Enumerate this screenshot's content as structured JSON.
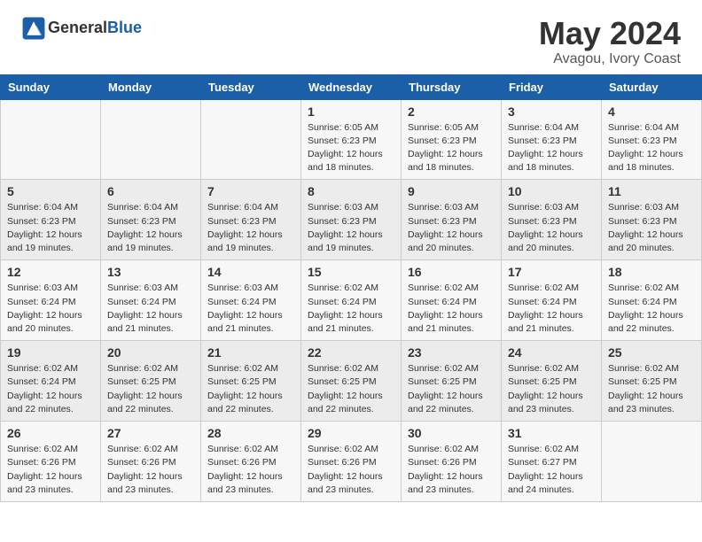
{
  "header": {
    "logo_line1": "General",
    "logo_line2": "Blue",
    "month": "May 2024",
    "location": "Avagou, Ivory Coast"
  },
  "weekdays": [
    "Sunday",
    "Monday",
    "Tuesday",
    "Wednesday",
    "Thursday",
    "Friday",
    "Saturday"
  ],
  "weeks": [
    [
      {
        "day": "",
        "info": ""
      },
      {
        "day": "",
        "info": ""
      },
      {
        "day": "",
        "info": ""
      },
      {
        "day": "1",
        "info": "Sunrise: 6:05 AM\nSunset: 6:23 PM\nDaylight: 12 hours\nand 18 minutes."
      },
      {
        "day": "2",
        "info": "Sunrise: 6:05 AM\nSunset: 6:23 PM\nDaylight: 12 hours\nand 18 minutes."
      },
      {
        "day": "3",
        "info": "Sunrise: 6:04 AM\nSunset: 6:23 PM\nDaylight: 12 hours\nand 18 minutes."
      },
      {
        "day": "4",
        "info": "Sunrise: 6:04 AM\nSunset: 6:23 PM\nDaylight: 12 hours\nand 18 minutes."
      }
    ],
    [
      {
        "day": "5",
        "info": "Sunrise: 6:04 AM\nSunset: 6:23 PM\nDaylight: 12 hours\nand 19 minutes."
      },
      {
        "day": "6",
        "info": "Sunrise: 6:04 AM\nSunset: 6:23 PM\nDaylight: 12 hours\nand 19 minutes."
      },
      {
        "day": "7",
        "info": "Sunrise: 6:04 AM\nSunset: 6:23 PM\nDaylight: 12 hours\nand 19 minutes."
      },
      {
        "day": "8",
        "info": "Sunrise: 6:03 AM\nSunset: 6:23 PM\nDaylight: 12 hours\nand 19 minutes."
      },
      {
        "day": "9",
        "info": "Sunrise: 6:03 AM\nSunset: 6:23 PM\nDaylight: 12 hours\nand 20 minutes."
      },
      {
        "day": "10",
        "info": "Sunrise: 6:03 AM\nSunset: 6:23 PM\nDaylight: 12 hours\nand 20 minutes."
      },
      {
        "day": "11",
        "info": "Sunrise: 6:03 AM\nSunset: 6:23 PM\nDaylight: 12 hours\nand 20 minutes."
      }
    ],
    [
      {
        "day": "12",
        "info": "Sunrise: 6:03 AM\nSunset: 6:24 PM\nDaylight: 12 hours\nand 20 minutes."
      },
      {
        "day": "13",
        "info": "Sunrise: 6:03 AM\nSunset: 6:24 PM\nDaylight: 12 hours\nand 21 minutes."
      },
      {
        "day": "14",
        "info": "Sunrise: 6:03 AM\nSunset: 6:24 PM\nDaylight: 12 hours\nand 21 minutes."
      },
      {
        "day": "15",
        "info": "Sunrise: 6:02 AM\nSunset: 6:24 PM\nDaylight: 12 hours\nand 21 minutes."
      },
      {
        "day": "16",
        "info": "Sunrise: 6:02 AM\nSunset: 6:24 PM\nDaylight: 12 hours\nand 21 minutes."
      },
      {
        "day": "17",
        "info": "Sunrise: 6:02 AM\nSunset: 6:24 PM\nDaylight: 12 hours\nand 21 minutes."
      },
      {
        "day": "18",
        "info": "Sunrise: 6:02 AM\nSunset: 6:24 PM\nDaylight: 12 hours\nand 22 minutes."
      }
    ],
    [
      {
        "day": "19",
        "info": "Sunrise: 6:02 AM\nSunset: 6:24 PM\nDaylight: 12 hours\nand 22 minutes."
      },
      {
        "day": "20",
        "info": "Sunrise: 6:02 AM\nSunset: 6:25 PM\nDaylight: 12 hours\nand 22 minutes."
      },
      {
        "day": "21",
        "info": "Sunrise: 6:02 AM\nSunset: 6:25 PM\nDaylight: 12 hours\nand 22 minutes."
      },
      {
        "day": "22",
        "info": "Sunrise: 6:02 AM\nSunset: 6:25 PM\nDaylight: 12 hours\nand 22 minutes."
      },
      {
        "day": "23",
        "info": "Sunrise: 6:02 AM\nSunset: 6:25 PM\nDaylight: 12 hours\nand 22 minutes."
      },
      {
        "day": "24",
        "info": "Sunrise: 6:02 AM\nSunset: 6:25 PM\nDaylight: 12 hours\nand 23 minutes."
      },
      {
        "day": "25",
        "info": "Sunrise: 6:02 AM\nSunset: 6:25 PM\nDaylight: 12 hours\nand 23 minutes."
      }
    ],
    [
      {
        "day": "26",
        "info": "Sunrise: 6:02 AM\nSunset: 6:26 PM\nDaylight: 12 hours\nand 23 minutes."
      },
      {
        "day": "27",
        "info": "Sunrise: 6:02 AM\nSunset: 6:26 PM\nDaylight: 12 hours\nand 23 minutes."
      },
      {
        "day": "28",
        "info": "Sunrise: 6:02 AM\nSunset: 6:26 PM\nDaylight: 12 hours\nand 23 minutes."
      },
      {
        "day": "29",
        "info": "Sunrise: 6:02 AM\nSunset: 6:26 PM\nDaylight: 12 hours\nand 23 minutes."
      },
      {
        "day": "30",
        "info": "Sunrise: 6:02 AM\nSunset: 6:26 PM\nDaylight: 12 hours\nand 23 minutes."
      },
      {
        "day": "31",
        "info": "Sunrise: 6:02 AM\nSunset: 6:27 PM\nDaylight: 12 hours\nand 24 minutes."
      },
      {
        "day": "",
        "info": ""
      }
    ]
  ]
}
